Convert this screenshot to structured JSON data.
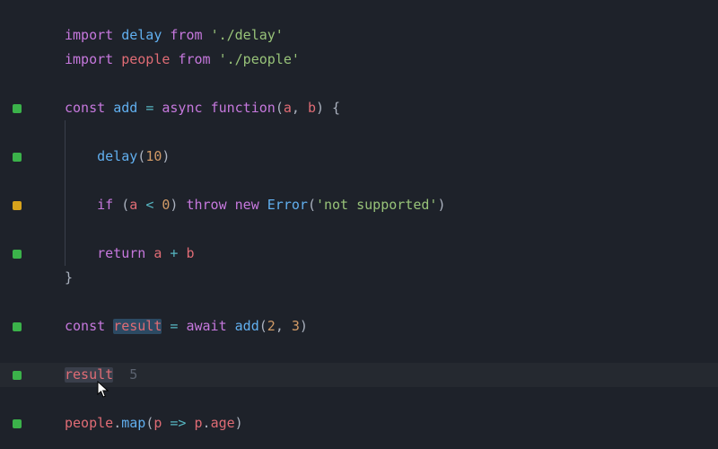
{
  "tokens": {
    "import": "import",
    "from": "from",
    "const": "const",
    "async": "async",
    "function": "function",
    "if": "if",
    "throw": "throw",
    "new": "new",
    "return": "return",
    "await": "await"
  },
  "idents": {
    "delay": "delay",
    "people": "people",
    "add": "add",
    "Error": "Error",
    "result": "result",
    "map": "map",
    "a": "a",
    "b": "b",
    "p": "p",
    "age": "age"
  },
  "strings": {
    "delay_path": "'./delay'",
    "people_path": "'./people'",
    "not_supported": "'not supported'"
  },
  "numbers": {
    "ten": "10",
    "zero": "0",
    "two": "2",
    "three": "3",
    "five": "5"
  },
  "punct": {
    "eq": "=",
    "lt": "<",
    "plus": "+",
    "arrow": "=>",
    "lparen": "(",
    "rparen": ")",
    "lbrace": "{",
    "rbrace": "}",
    "comma": ",",
    "dot": ".",
    "sp": " ",
    "sp4": "    "
  },
  "markers": {
    "l4": "green",
    "l6": "green",
    "l8": "yellow",
    "l10": "green",
    "l13": "green",
    "l15": "green",
    "l17": "green"
  },
  "inline_result": "5"
}
